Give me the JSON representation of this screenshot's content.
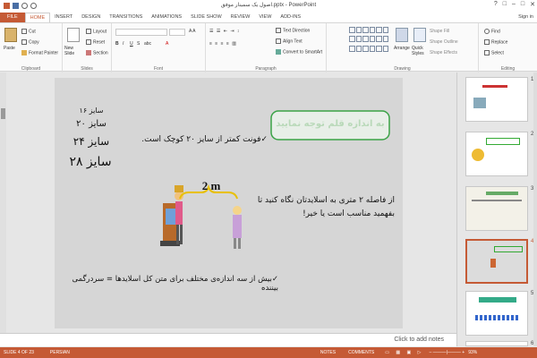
{
  "window": {
    "title": "اصول یک سمینار موفق.pptx - PowerPoint",
    "controls": [
      "?",
      "□",
      "–",
      "□",
      "✕"
    ],
    "sign_in": "Sign in"
  },
  "tabs": [
    "FILE",
    "HOME",
    "INSERT",
    "DESIGN",
    "TRANSITIONS",
    "ANIMATIONS",
    "SLIDE SHOW",
    "REVIEW",
    "VIEW",
    "ADD-INS"
  ],
  "ribbon": {
    "clipboard": {
      "label": "Clipboard",
      "paste": "Paste",
      "cut": "Cut",
      "copy": "Copy",
      "format_painter": "Format Painter"
    },
    "slides": {
      "label": "Slides",
      "new_slide": "New Slide",
      "layout": "Layout",
      "reset": "Reset",
      "section": "Section"
    },
    "font": {
      "label": "Font"
    },
    "paragraph": {
      "label": "Paragraph",
      "text_direction": "Text Direction",
      "align_text": "Align Text",
      "convert_smartart": "Convert to SmartArt"
    },
    "drawing": {
      "label": "Drawing",
      "arrange": "Arrange",
      "quick_styles": "Quick Styles",
      "shape_fill": "Shape Fill",
      "shape_outline": "Shape Outline",
      "shape_effects": "Shape Effects"
    },
    "editing": {
      "label": "Editing",
      "find": "Find",
      "replace": "Replace",
      "select": "Select"
    }
  },
  "slide": {
    "title": "به اندازه قلم توجه نمایید",
    "sizes": [
      "سایز ۱۶",
      "سایز ۲۰",
      "سایز ۲۴",
      "سایز ۲۸"
    ],
    "bullet1": "فونت کمتر از سایز ۲۰ کوچک است.",
    "distance": "2 m",
    "question": "از فاصله ۲ متری به اسلایدتان نگاه کنید تا بفهمید مناسب است یا خیر!",
    "bullet2": "بیش از سه اندازه‌ی مختلف برای متن کل اسلایدها = سردرگمی بیننده"
  },
  "notes_placeholder": "Click to add notes",
  "thumbnails": [
    "1",
    "2",
    "3",
    "4",
    "5",
    "6"
  ],
  "status": {
    "slide_info": "SLIDE 4 OF 23",
    "language": "PERSIAN",
    "notes": "NOTES",
    "comments": "COMMENTS",
    "zoom": "93%"
  },
  "colors": {
    "accent": "#c55a35",
    "slide_bg": "#d6d6d6",
    "title_border": "#3aa346"
  }
}
